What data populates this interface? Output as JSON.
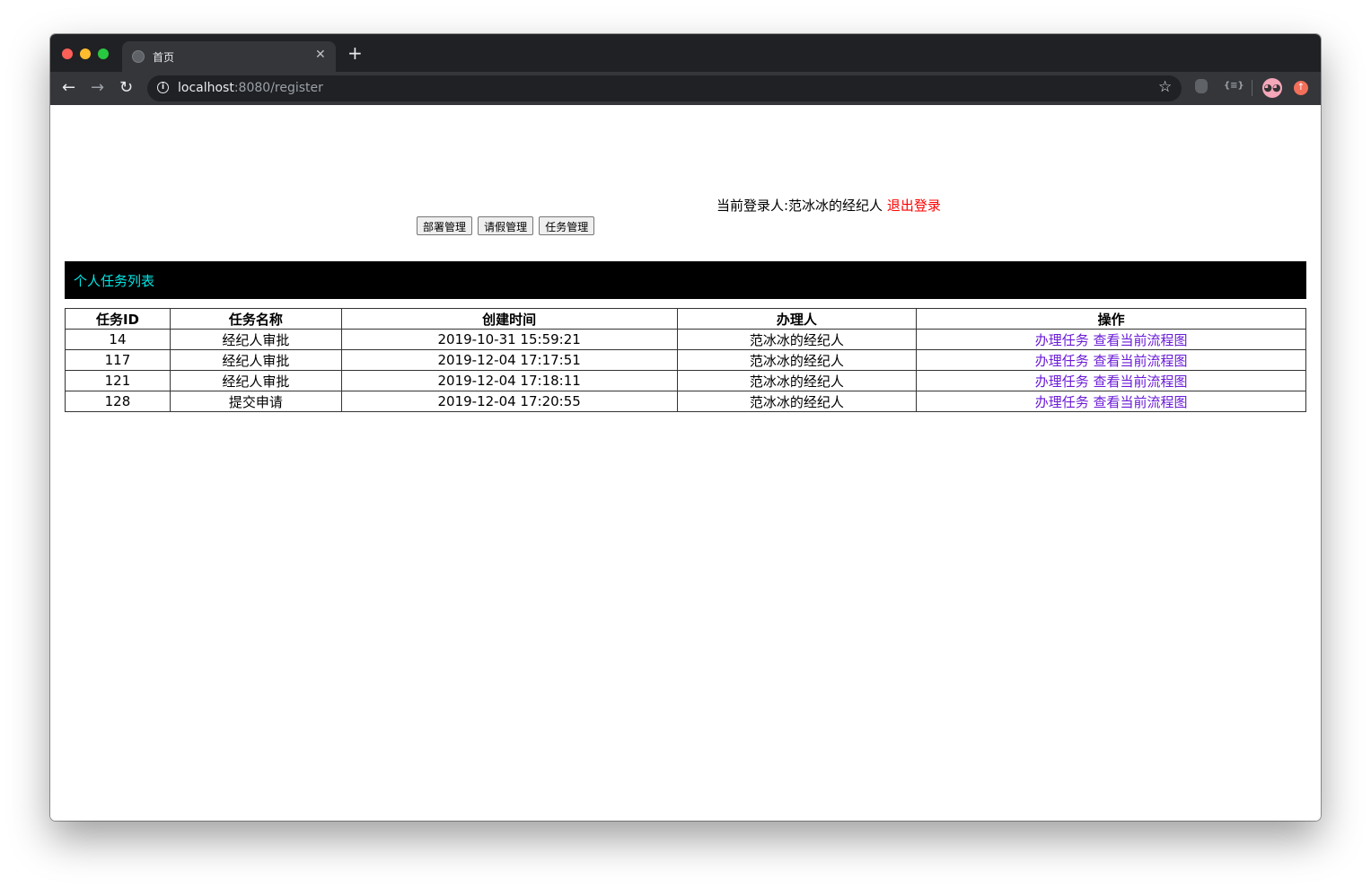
{
  "browser": {
    "tab_title": "首页",
    "tab_close": "✕",
    "new_tab": "+",
    "url_host": "localhost",
    "url_rest": ":8080/register",
    "back": "←",
    "forward": "→",
    "reload": "↻",
    "star": "☆"
  },
  "page": {
    "login_label": "当前登录人:范冰冰的经纪人",
    "logout": "退出登录",
    "buttons": [
      "部署管理",
      "请假管理",
      "任务管理"
    ],
    "list_title": "个人任务列表"
  },
  "table": {
    "headers": [
      "任务ID",
      "任务名称",
      "创建时间",
      "办理人",
      "操作"
    ],
    "rows": [
      {
        "id": "14",
        "name": "经纪人审批",
        "time": "2019-10-31 15:59:21",
        "assignee": "范冰冰的经纪人"
      },
      {
        "id": "117",
        "name": "经纪人审批",
        "time": "2019-12-04 17:17:51",
        "assignee": "范冰冰的经纪人"
      },
      {
        "id": "121",
        "name": "经纪人审批",
        "time": "2019-12-04 17:18:11",
        "assignee": "范冰冰的经纪人"
      },
      {
        "id": "128",
        "name": "提交申请",
        "time": "2019-12-04 17:20:55",
        "assignee": "范冰冰的经纪人"
      }
    ],
    "action_handle": "办理任务",
    "action_view": "查看当前流程图"
  },
  "colors": {
    "list_header_bg": "#000000",
    "list_title": "#00e5e5",
    "logout": "#ff0000",
    "action_link": "#6a1bd6"
  }
}
